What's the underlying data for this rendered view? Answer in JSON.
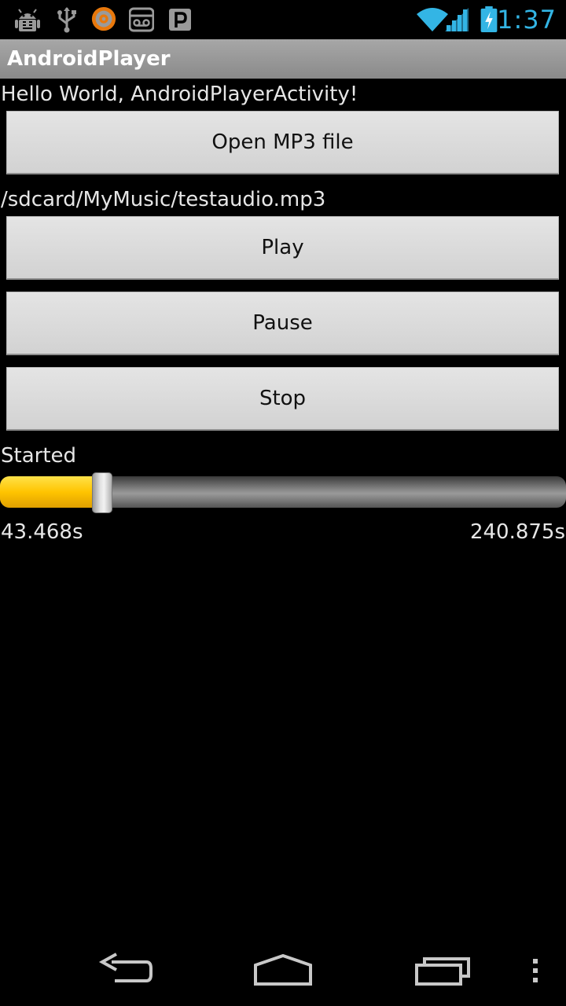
{
  "status_bar": {
    "time": "1:37",
    "accent_color": "#33b5e5",
    "left_icons": [
      "android-debug-icon",
      "usb-icon",
      "orange-app-icon",
      "voicemail-icon",
      "parking-icon"
    ],
    "right_icons": [
      "wifi-icon",
      "signal-icon",
      "battery-charging-icon"
    ]
  },
  "title_bar": {
    "title": "AndroidPlayer"
  },
  "content": {
    "hello_text": "Hello World, AndroidPlayerActivity!",
    "open_button": "Open MP3 file",
    "file_path": "/sdcard/MyMusic/testaudio.mp3",
    "play_button": "Play",
    "pause_button": "Pause",
    "stop_button": "Stop",
    "status_text": "Started",
    "seekbar": {
      "progress_fraction": 0.18,
      "fill_color": "#ffc400"
    },
    "current_time": "43.468s",
    "total_time": "240.875s"
  },
  "nav_bar": {
    "icons": [
      "back-icon",
      "home-icon",
      "recent-apps-icon",
      "overflow-menu-icon"
    ]
  }
}
